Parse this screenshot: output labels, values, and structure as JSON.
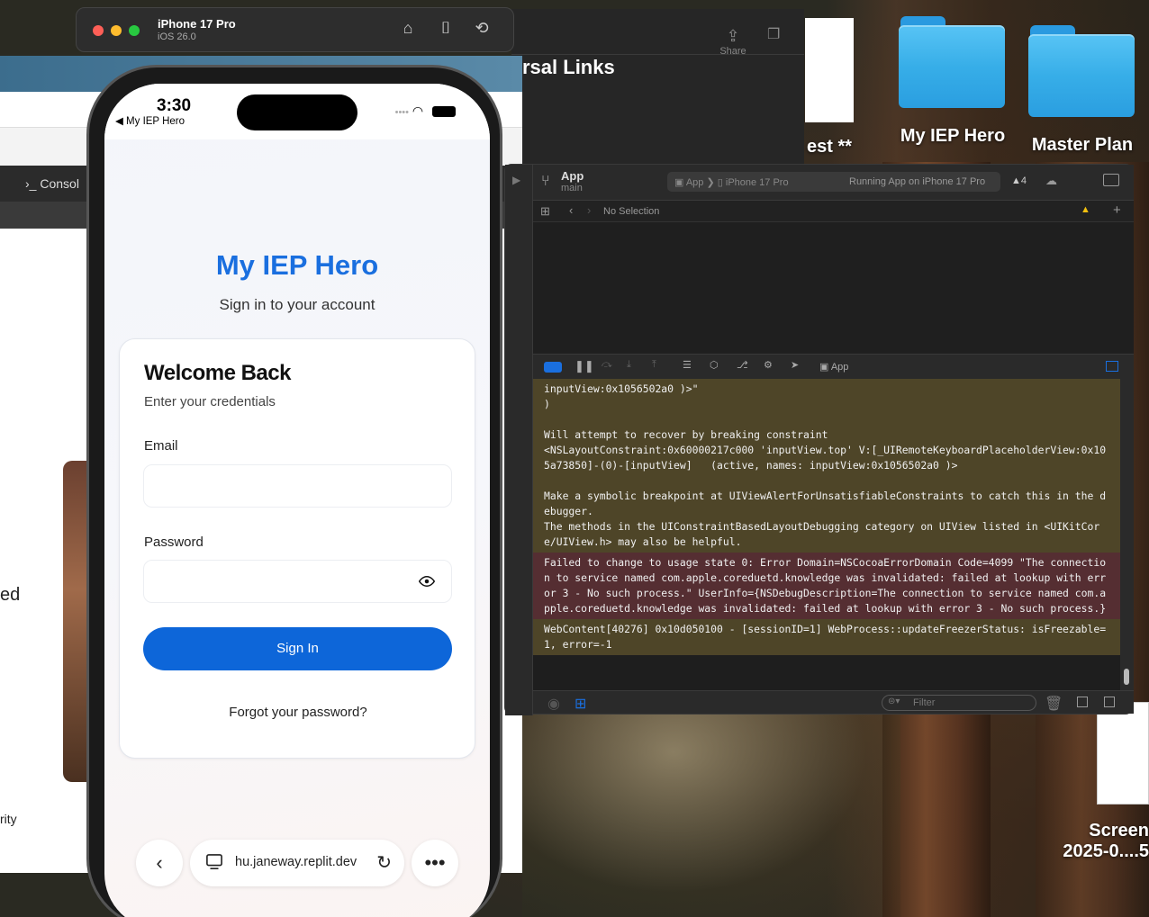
{
  "desktop": {
    "folders": [
      {
        "label": "My IEP Hero"
      },
      {
        "label": "Master Plan"
      }
    ],
    "partial_label_1": "est **",
    "screenshot_label_1": "Screen",
    "screenshot_label_2": "2025-0....5"
  },
  "simulator": {
    "device": "iPhone 17 Pro",
    "os": "iOS 26.0"
  },
  "background_window": {
    "title_partial": "rsal Links",
    "share_label": "Share",
    "console_label": "Consol",
    "text_ed": "ed",
    "text_rity": "rity"
  },
  "xcode": {
    "app_name": "App",
    "branch": "main",
    "scheme_target": "App",
    "scheme_device": "iPhone 17 Pro",
    "status": "Running App on iPhone 17 Pro",
    "warnings": "4",
    "jump_bar": "No Selection",
    "debug_target": "App",
    "filter_placeholder": "Filter",
    "console": [
      {
        "level": "warn",
        "text": "inputView:0x1056502a0 )>\"\n)\n\nWill attempt to recover by breaking constraint\n<NSLayoutConstraint:0x60000217c000 'inputView.top' V:[_UIRemoteKeyboardPlaceholderView:0x105a73850]-(0)-[inputView]   (active, names: inputView:0x1056502a0 )>\n\nMake a symbolic breakpoint at UIViewAlertForUnsatisfiableConstraints to catch this in the debugger.\nThe methods in the UIConstraintBasedLayoutDebugging category on UIView listed in <UIKitCore/UIView.h> may also be helpful."
      },
      {
        "level": "err",
        "text": "Failed to change to usage state 0: Error Domain=NSCocoaErrorDomain Code=4099 \"The connection to service named com.apple.coreduetd.knowledge was invalidated: failed at lookup with error 3 - No such process.\" UserInfo={NSDebugDescription=The connection to service named com.apple.coreduetd.knowledge was invalidated: failed at lookup with error 3 - No such process.}"
      },
      {
        "level": "warn",
        "text": "WebContent[40276] 0x10d050100 - [sessionID=1] WebProcess::updateFreezerStatus: isFreezable=1, error=-1"
      }
    ]
  },
  "phone": {
    "time": "3:30",
    "back_app": "◀ My IEP Hero",
    "app_title": "My IEP Hero",
    "app_subtitle": "Sign in to your account",
    "card_title": "Welcome Back",
    "card_hint": "Enter your credentials",
    "email_label": "Email",
    "email_value": "",
    "password_label": "Password",
    "password_value": "",
    "sign_in": "Sign In",
    "forgot": "Forgot your password?",
    "url": "hu.janeway.replit.dev",
    "accent_color": "#0d66d9",
    "title_color": "#1a6fdf"
  }
}
